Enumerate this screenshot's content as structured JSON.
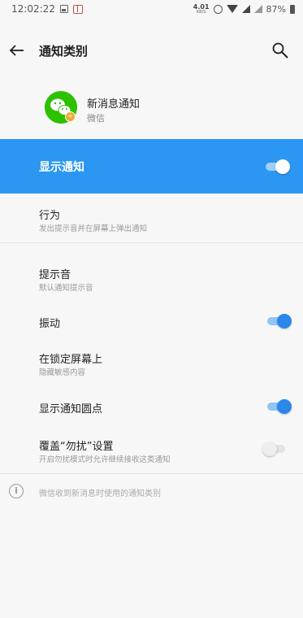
{
  "status_bar": {
    "time": "12:02:22",
    "net_speed_value": "4.01",
    "net_speed_unit": "KB/S",
    "battery": "87%"
  },
  "toolbar": {
    "title": "通知类别"
  },
  "app": {
    "name": "新消息通知",
    "sub": "微信"
  },
  "show_notification": {
    "label": "显示通知",
    "on": true
  },
  "items": [
    {
      "title": "行为",
      "sub": "发出提示音并在屏幕上弹出通知"
    },
    {
      "title": "提示音",
      "sub": "默认通知提示音"
    },
    {
      "title": "振动",
      "on": true
    },
    {
      "title": "在锁定屏幕上",
      "sub": "隐藏敏感内容"
    },
    {
      "title": "显示通知圆点",
      "on": true
    },
    {
      "title": "覆盖“勿扰”设置",
      "sub": "开启勿扰模式时允许继续接收这类通知",
      "on": false
    }
  ],
  "footer": {
    "info_text": "微信收到新消息时使用的通知类别"
  },
  "colors": {
    "accent": "#2b97f2",
    "toggle_on": "#2b87ea",
    "wechat_green": "#2dc100"
  },
  "icons": [
    "back-arrow-icon",
    "search-icon",
    "wechat-icon",
    "info-icon",
    "alarm-icon",
    "wifi-icon",
    "signal-icon",
    "battery-icon"
  ]
}
